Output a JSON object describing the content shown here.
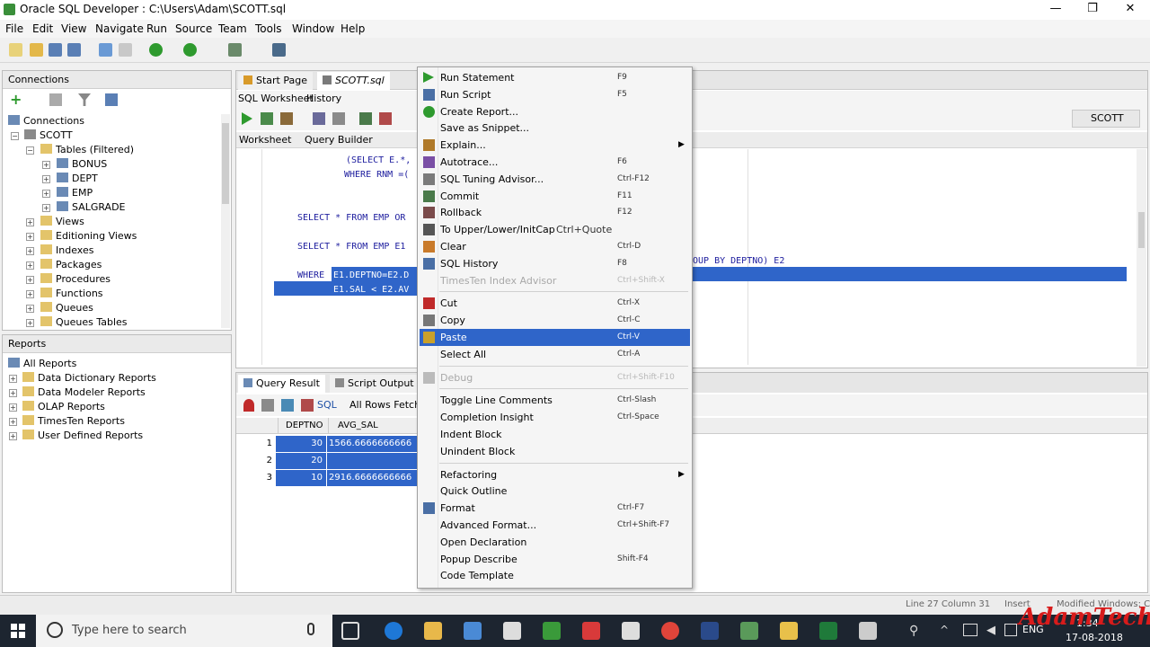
{
  "window": {
    "title": "Oracle SQL Developer : C:\\Users\\Adam\\SCOTT.sql",
    "minimize": "—",
    "maximize": "❐",
    "close": "✕"
  },
  "menu": [
    "File",
    "Edit",
    "View",
    "Navigate",
    "Run",
    "Source",
    "Team",
    "Tools",
    "Window",
    "Help"
  ],
  "connections_panel": {
    "header": "Connections",
    "tree": [
      {
        "label": "Connections",
        "depth": 0
      },
      {
        "label": "SCOTT",
        "depth": 1
      },
      {
        "label": "Tables (Filtered)",
        "depth": 2
      },
      {
        "label": "BONUS",
        "depth": 3
      },
      {
        "label": "DEPT",
        "depth": 3
      },
      {
        "label": "EMP",
        "depth": 3
      },
      {
        "label": "SALGRADE",
        "depth": 3
      },
      {
        "label": "Views",
        "depth": 2
      },
      {
        "label": "Editioning Views",
        "depth": 2
      },
      {
        "label": "Indexes",
        "depth": 2
      },
      {
        "label": "Packages",
        "depth": 2
      },
      {
        "label": "Procedures",
        "depth": 2
      },
      {
        "label": "Functions",
        "depth": 2
      },
      {
        "label": "Queues",
        "depth": 2
      },
      {
        "label": "Queues Tables",
        "depth": 2
      }
    ]
  },
  "reports_panel": {
    "header": "Reports",
    "tree": [
      {
        "label": "All Reports",
        "depth": 0
      },
      {
        "label": "Data Dictionary Reports",
        "depth": 1
      },
      {
        "label": "Data Modeler Reports",
        "depth": 1
      },
      {
        "label": "OLAP Reports",
        "depth": 1
      },
      {
        "label": "TimesTen Reports",
        "depth": 1
      },
      {
        "label": "User Defined Reports",
        "depth": 1
      }
    ]
  },
  "editor": {
    "tabs": [
      "Start Page",
      "SCOTT.sql"
    ],
    "subtabs": [
      "SQL Worksheet",
      "History"
    ],
    "inner_tabs": [
      "Worksheet",
      "Query Builder"
    ],
    "connection": "SCOTT",
    "code_lines": [
      "(SELECT E.*,",
      "WHERE RNM =(",
      "SELECT * FROM EMP OR",
      "SELECT * FROM EMP E1",
      "WHERE",
      "E1.DEPTNO=E2.D",
      "E1.SAL < E2.AV",
      "OUP BY DEPTNO) E2"
    ]
  },
  "results": {
    "tabs": [
      "Query Result",
      "Script Output"
    ],
    "sql_label": "SQL",
    "status": "All Rows Fetched",
    "columns": [
      "DEPTNO",
      "AVG_SAL"
    ],
    "rows": [
      {
        "n": "1",
        "deptno": "30",
        "avg_sal": "1566.6666666666"
      },
      {
        "n": "2",
        "deptno": "20",
        "avg_sal": ""
      },
      {
        "n": "3",
        "deptno": "10",
        "avg_sal": "2916.6666666666"
      }
    ]
  },
  "context_menu": {
    "items": [
      {
        "label": "Run Statement",
        "shortcut": "F9",
        "icon": "run-statement-icon",
        "color": "#2e9a2e"
      },
      {
        "label": "Run Script",
        "shortcut": "F5",
        "icon": "run-script-icon",
        "color": "#4a6fa5"
      },
      {
        "label": "Create Report...",
        "shortcut": "",
        "icon": "create-report-icon",
        "color": "#2e9a2e"
      },
      {
        "label": "Save as Snippet...",
        "shortcut": "",
        "icon": "",
        "color": ""
      },
      {
        "label": "Explain...",
        "shortcut": "",
        "icon": "explain-icon",
        "color": "#b07a2a",
        "submenu": true
      },
      {
        "label": "Autotrace...",
        "shortcut": "F6",
        "icon": "autotrace-icon",
        "color": "#7a4fa5"
      },
      {
        "label": "SQL Tuning Advisor...",
        "shortcut": "Ctrl-F12",
        "icon": "tuning-advisor-icon",
        "color": "#7a7a7a"
      },
      {
        "label": "Commit",
        "shortcut": "F11",
        "icon": "commit-icon",
        "color": "#4a7a4a"
      },
      {
        "label": "Rollback",
        "shortcut": "F12",
        "icon": "rollback-icon",
        "color": "#7a4a4a"
      },
      {
        "label": "To Upper/Lower/InitCap",
        "shortcut": "Ctrl+Quote",
        "icon": "case-icon",
        "color": "#555"
      },
      {
        "label": "Clear",
        "shortcut": "Ctrl-D",
        "icon": "clear-icon",
        "color": "#c97a2a"
      },
      {
        "label": "SQL History",
        "shortcut": "F8",
        "icon": "history-icon",
        "color": "#4a6fa5"
      },
      {
        "label": "TimesTen Index Advisor",
        "shortcut": "Ctrl+Shift-X",
        "icon": "",
        "color": "",
        "disabled": true
      },
      {
        "sep": true
      },
      {
        "label": "Cut",
        "shortcut": "Ctrl-X",
        "icon": "cut-icon",
        "color": "#c02a2a"
      },
      {
        "label": "Copy",
        "shortcut": "Ctrl-C",
        "icon": "copy-icon",
        "color": "#777"
      },
      {
        "label": "Paste",
        "shortcut": "Ctrl-V",
        "icon": "paste-icon",
        "color": "#c9a02a",
        "selected": true
      },
      {
        "label": "Select All",
        "shortcut": "Ctrl-A",
        "icon": "",
        "color": ""
      },
      {
        "sep": true
      },
      {
        "label": "Debug",
        "shortcut": "Ctrl+Shift-F10",
        "icon": "debug-icon",
        "color": "#bbb",
        "disabled": true
      },
      {
        "sep": true
      },
      {
        "label": "Toggle Line Comments",
        "shortcut": "Ctrl-Slash",
        "icon": "",
        "color": ""
      },
      {
        "label": "Completion Insight",
        "shortcut": "Ctrl-Space",
        "icon": "",
        "color": ""
      },
      {
        "label": "Indent Block",
        "shortcut": "",
        "icon": "",
        "color": ""
      },
      {
        "label": "Unindent Block",
        "shortcut": "",
        "icon": "",
        "color": ""
      },
      {
        "sep": true
      },
      {
        "label": "Refactoring",
        "shortcut": "",
        "icon": "",
        "color": "",
        "submenu": true
      },
      {
        "label": "Quick Outline",
        "shortcut": "",
        "icon": "",
        "color": ""
      },
      {
        "label": "Format",
        "shortcut": "Ctrl-F7",
        "icon": "format-icon",
        "color": "#4a6fa5"
      },
      {
        "label": "Advanced Format...",
        "shortcut": "Ctrl+Shift-F7",
        "icon": "",
        "color": ""
      },
      {
        "label": "Open Declaration",
        "shortcut": "",
        "icon": "",
        "color": ""
      },
      {
        "label": "Popup Describe",
        "shortcut": "Shift-F4",
        "icon": "",
        "color": ""
      },
      {
        "label": "Code Template",
        "shortcut": "",
        "icon": "",
        "color": ""
      }
    ]
  },
  "statusbar": {
    "position": "Line 27 Column 31",
    "mode": "Insert",
    "modified": "Modified",
    "platform": "Windows: C"
  },
  "taskbar": {
    "search_placeholder": "Type here to search",
    "language": "ENG",
    "time": "1:34",
    "date": "17-08-2018"
  },
  "watermark": "AdamTech",
  "colors": {
    "selection": "#2f65c9",
    "taskbar": "#1d2530",
    "watermark": "#d81b1b"
  }
}
